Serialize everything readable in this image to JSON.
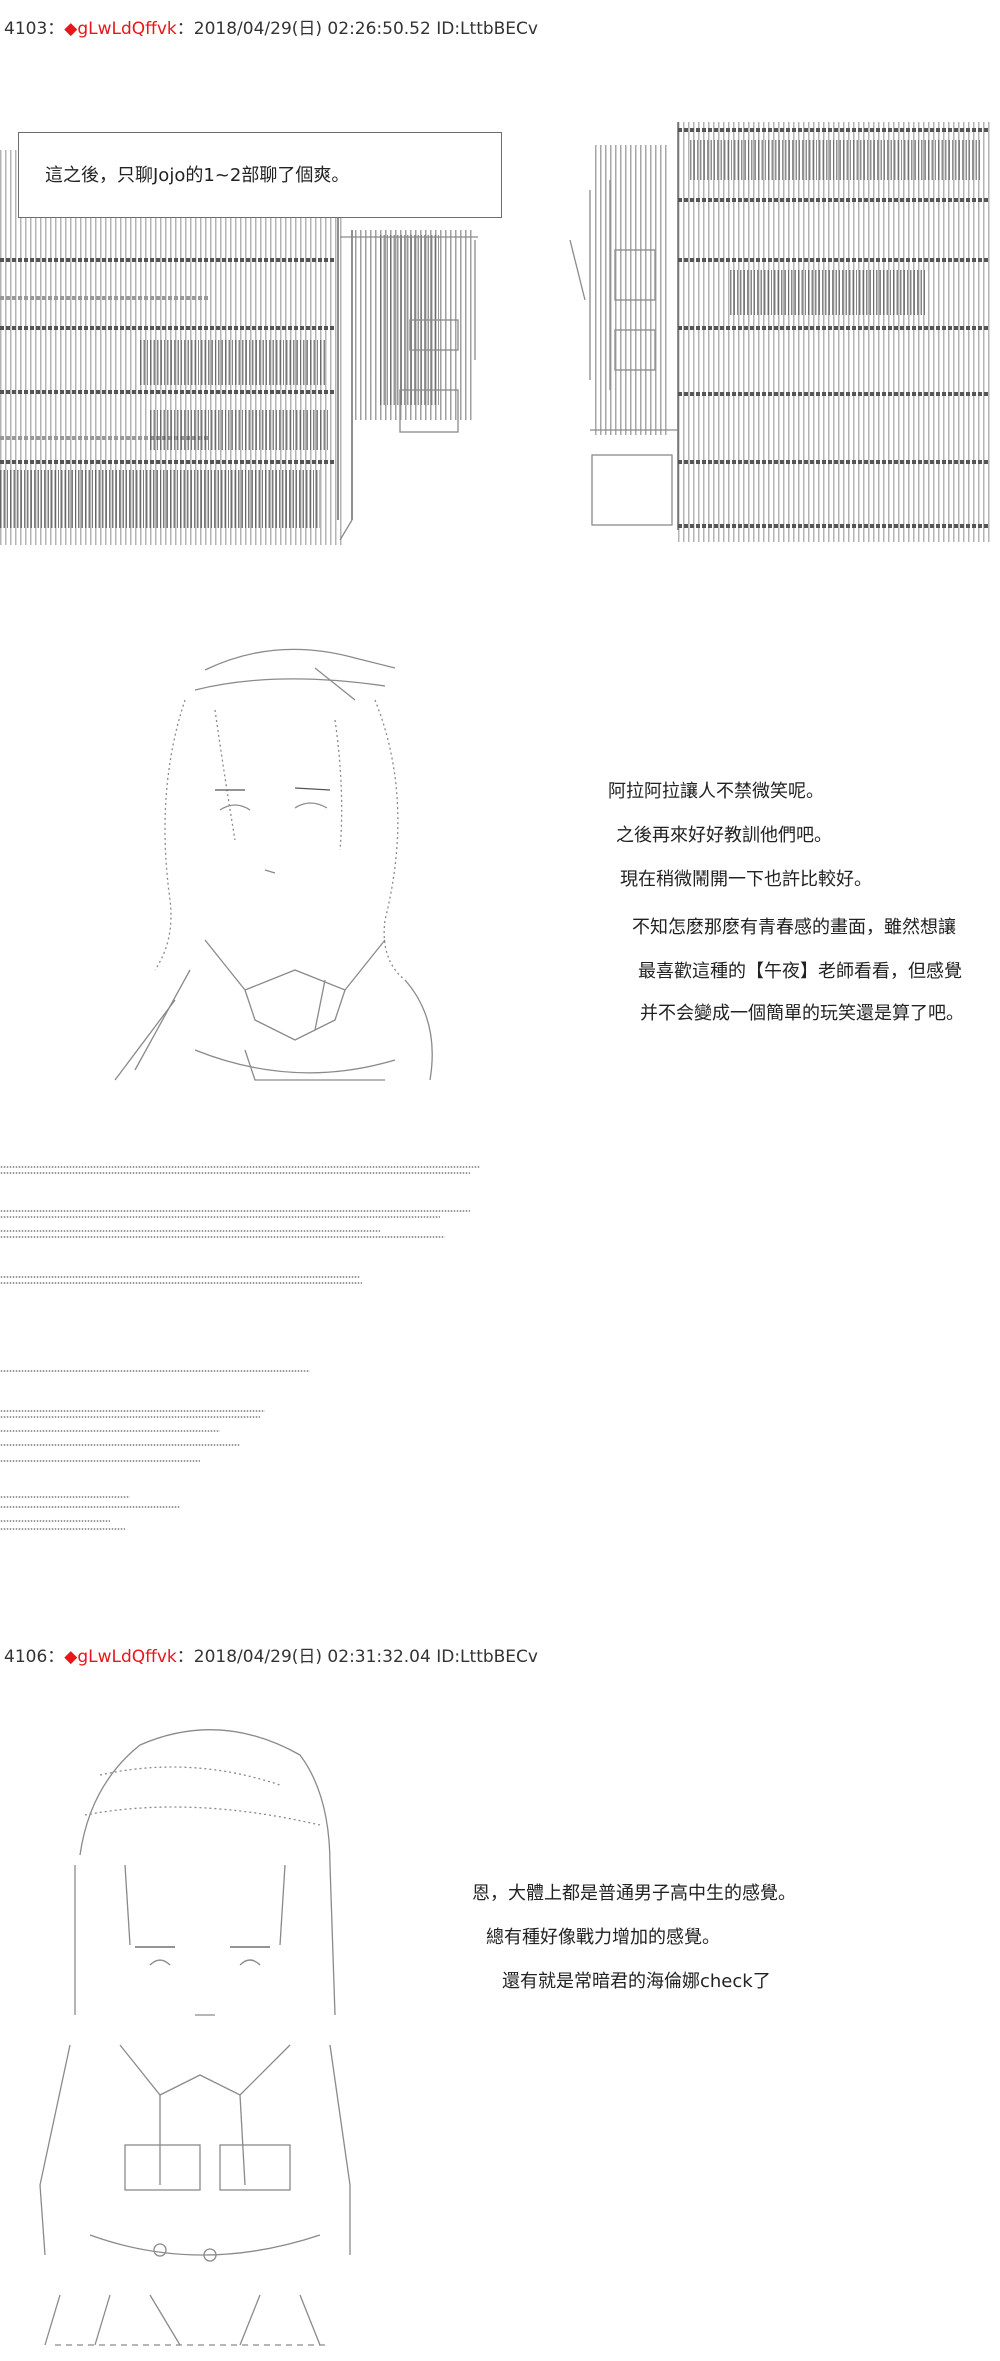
{
  "posts": [
    {
      "number": "4103",
      "separator": "：",
      "diamond": "◆",
      "trip": "gLwLdQffvk",
      "meta": "：2018/04/29(日) 02:26:50.52 ID:LttbBECv",
      "caption": "這之後，只聊Jojo的1~2部聊了個爽。",
      "lines": [
        "阿拉阿拉讓人不禁微笑呢。",
        "之後再來好好教訓他們吧。",
        "現在稍微鬧開一下也許比較好。",
        "不知怎麽那麽有青春感的畫面，雖然想讓",
        "最喜歡這種的【午夜】老師看看，但感覺",
        "并不会變成一個簡單的玩笑還是算了吧。"
      ]
    },
    {
      "number": "4106",
      "separator": "：",
      "diamond": "◆",
      "trip": "gLwLdQffvk",
      "meta": "：2018/04/29(日) 02:31:32.04 ID:LttbBECv",
      "lines": [
        "恩，大體上都是普通男子高中生的感覺。",
        "總有種好像戰力增加的感覺。",
        "還有就是常暗君的海倫娜check了"
      ]
    }
  ]
}
